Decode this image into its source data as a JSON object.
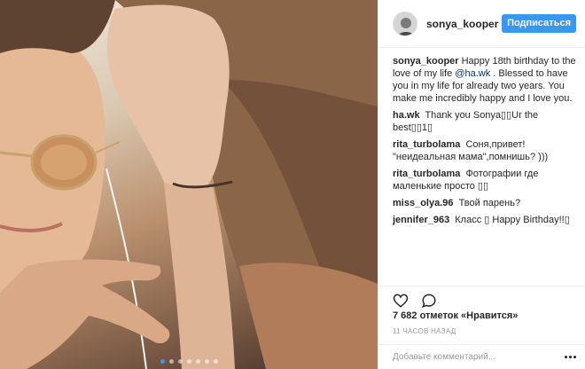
{
  "post": {
    "photo": {
      "description_icon": "selfie-photo",
      "carousel_dots": 7,
      "active_dot": 0
    }
  },
  "header": {
    "username": "sonya_kooper",
    "follow_label": "Подписаться"
  },
  "caption": {
    "username": "sonya_kooper",
    "text_before": "Happy 18th birthday to the love of my life ",
    "mention": "@ha.wk",
    "text_after": " . Blessed to have you in my life for already two years. You make me incredibly happy and I love you."
  },
  "comments": [
    {
      "username": "ha.wk",
      "text": "Thank you Sonya▯▯Ur the best▯▯1▯"
    },
    {
      "username": "rita_turbolama",
      "text": "Соня,привет! \"неидеальная мама\",помнишь? )))"
    },
    {
      "username": "rita_turbolama",
      "text": "Фотографии где маленькие просто ▯▯"
    },
    {
      "username": "miss_olya.96",
      "text": "Твой парень?"
    },
    {
      "username": "jennifer_963",
      "text": "Класс ▯ Happy Birthday!!▯"
    }
  ],
  "actions": {
    "like_icon": "heart-icon",
    "comment_icon": "comment-icon"
  },
  "likes_text": "7 682 отметок «Нравится»",
  "time_text": "11 часов назад",
  "add_comment": {
    "placeholder": "Добавьте комментарий..."
  },
  "colors": {
    "accent": "#3897f0",
    "mention": "#003569",
    "border": "#efefef",
    "muted": "#999999"
  }
}
